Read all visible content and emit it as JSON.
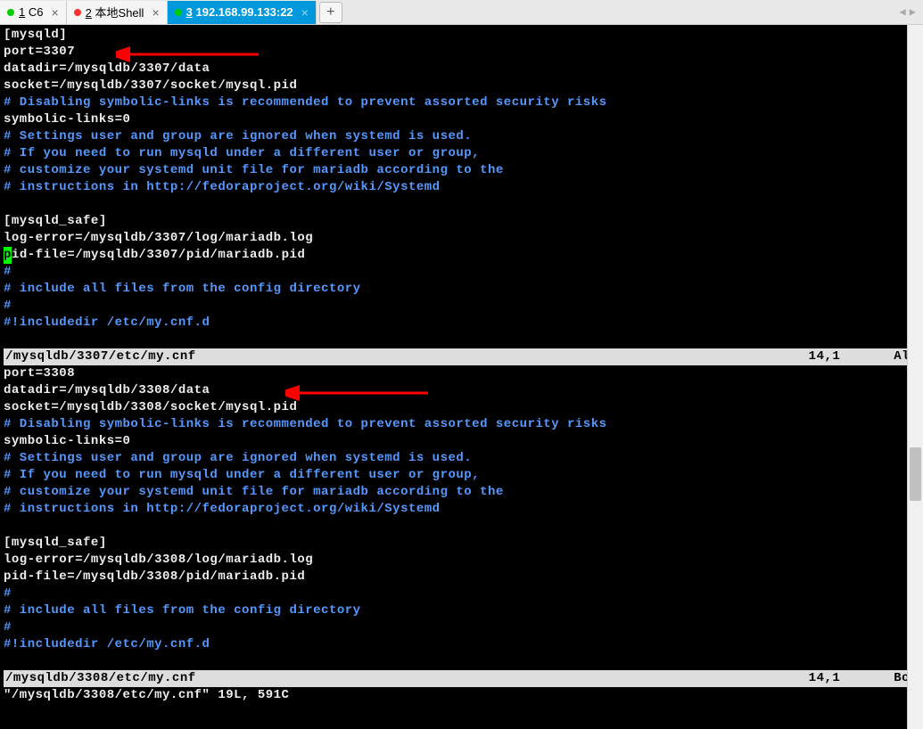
{
  "tabs": [
    {
      "dot": "green",
      "num": "1",
      "label": "C6"
    },
    {
      "dot": "red",
      "num": "2",
      "label": "本地Shell"
    },
    {
      "dot": "green",
      "num": "3",
      "label": "192.168.99.133:22",
      "active": true
    }
  ],
  "tab_add": "+",
  "pane1": {
    "lines": [
      {
        "cls": "white",
        "text": "[mysqld]"
      },
      {
        "cls": "white",
        "text": "port=3307"
      },
      {
        "cls": "white",
        "text": "datadir=/mysqldb/3307/data"
      },
      {
        "cls": "white",
        "text": "socket=/mysqldb/3307/socket/mysql.pid"
      },
      {
        "cls": "cyan",
        "text": "# Disabling symbolic-links is recommended to prevent assorted security risks"
      },
      {
        "cls": "white",
        "text": "symbolic-links=0"
      },
      {
        "cls": "cyan",
        "text": "# Settings user and group are ignored when systemd is used."
      },
      {
        "cls": "cyan",
        "text": "# If you need to run mysqld under a different user or group,"
      },
      {
        "cls": "cyan",
        "text": "# customize your systemd unit file for mariadb according to the"
      },
      {
        "cls": "cyan",
        "text": "# instructions in http://fedoraproject.org/wiki/Systemd"
      },
      {
        "cls": "white",
        "text": ""
      },
      {
        "cls": "white",
        "text": "[mysqld_safe]"
      },
      {
        "cls": "white",
        "text": "log-error=/mysqldb/3307/log/mariadb.log"
      },
      {
        "cls": "white",
        "text": "*CURSOR*id-file=/mysqldb/3307/pid/mariadb.pid"
      },
      {
        "cls": "cyan",
        "text": "#"
      },
      {
        "cls": "cyan",
        "text": "# include all files from the config directory"
      },
      {
        "cls": "cyan",
        "text": "#"
      },
      {
        "cls": "cyan",
        "text": "#!includedir /etc/my.cnf.d"
      },
      {
        "cls": "white",
        "text": ""
      }
    ],
    "status": {
      "path": "/mysqldb/3307/etc/my.cnf",
      "pos": "14,1",
      "pct": "All"
    }
  },
  "pane2": {
    "lines": [
      {
        "cls": "white",
        "text": "port=3308"
      },
      {
        "cls": "white",
        "text": "datadir=/mysqldb/3308/data"
      },
      {
        "cls": "white",
        "text": "socket=/mysqldb/3308/socket/mysql.pid"
      },
      {
        "cls": "cyan",
        "text": "# Disabling symbolic-links is recommended to prevent assorted security risks"
      },
      {
        "cls": "white",
        "text": "symbolic-links=0"
      },
      {
        "cls": "cyan",
        "text": "# Settings user and group are ignored when systemd is used."
      },
      {
        "cls": "cyan",
        "text": "# If you need to run mysqld under a different user or group,"
      },
      {
        "cls": "cyan",
        "text": "# customize your systemd unit file for mariadb according to the"
      },
      {
        "cls": "cyan",
        "text": "# instructions in http://fedoraproject.org/wiki/Systemd"
      },
      {
        "cls": "white",
        "text": ""
      },
      {
        "cls": "white",
        "text": "[mysqld_safe]"
      },
      {
        "cls": "white",
        "text": "log-error=/mysqldb/3308/log/mariadb.log"
      },
      {
        "cls": "white",
        "text": "pid-file=/mysqldb/3308/pid/mariadb.pid"
      },
      {
        "cls": "cyan",
        "text": "#"
      },
      {
        "cls": "cyan",
        "text": "# include all files from the config directory"
      },
      {
        "cls": "cyan",
        "text": "#"
      },
      {
        "cls": "cyan",
        "text": "#!includedir /etc/my.cnf.d"
      },
      {
        "cls": "white",
        "text": ""
      }
    ],
    "status": {
      "path": "/mysqldb/3308/etc/my.cnf",
      "pos": "14,1",
      "pct": "Bot"
    }
  },
  "footer": "\"/mysqldb/3308/etc/my.cnf\" 19L, 591C"
}
